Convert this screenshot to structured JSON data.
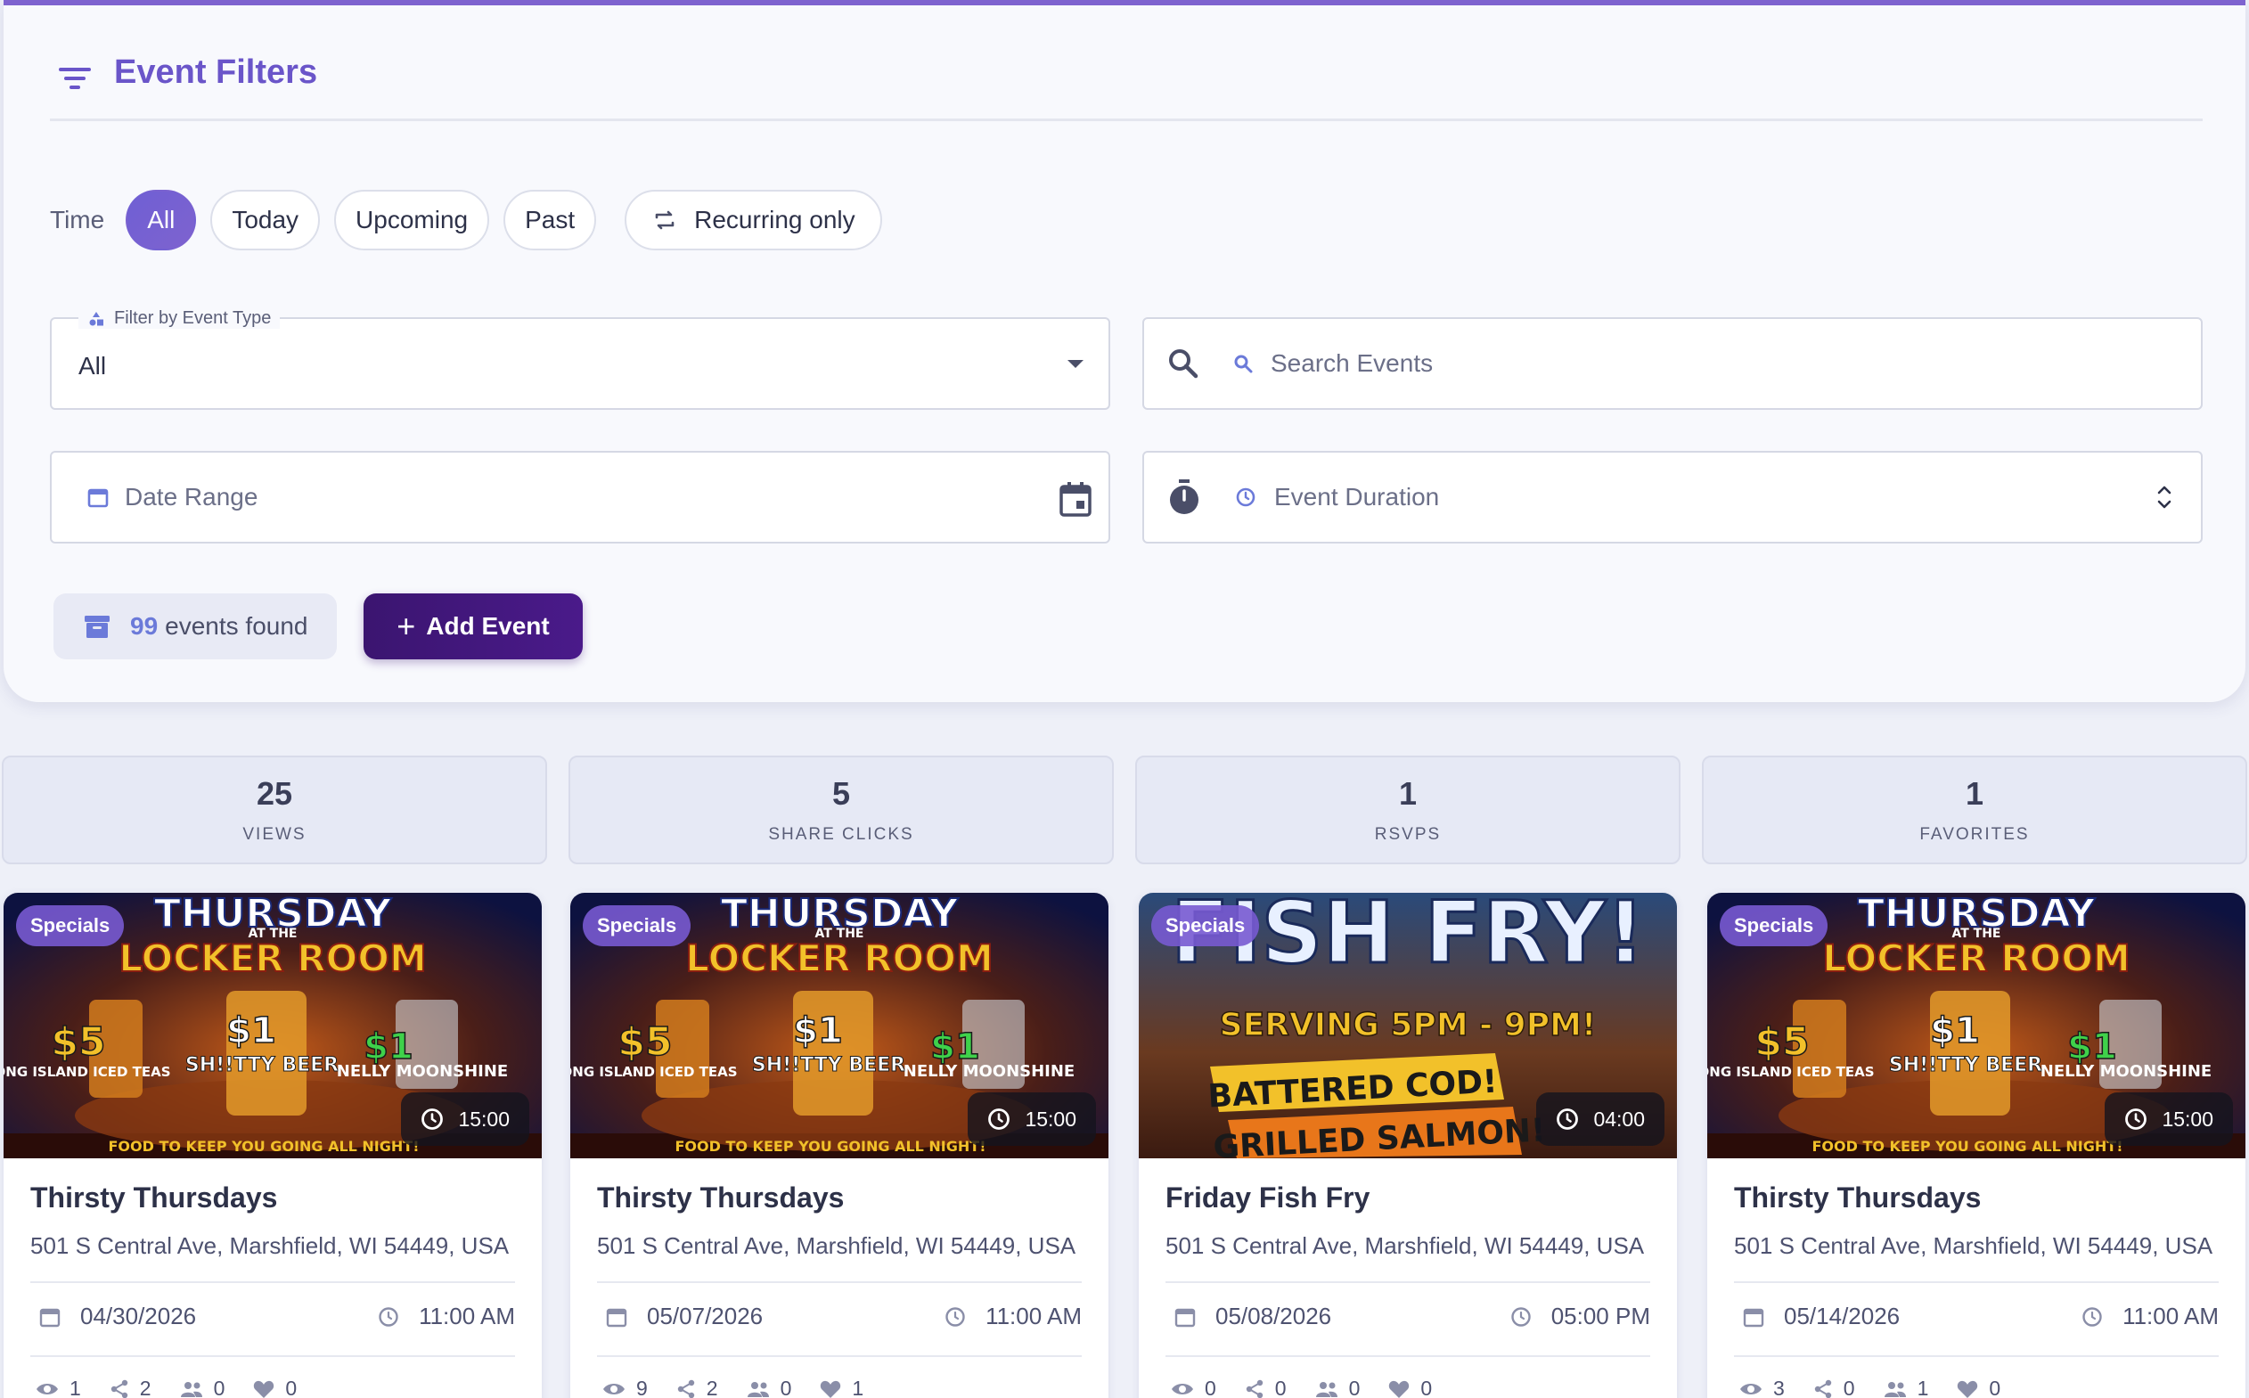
{
  "filters": {
    "title": "Event Filters",
    "time_label": "Time",
    "time_chips": [
      "All",
      "Today",
      "Upcoming",
      "Past"
    ],
    "recurring_label": "Recurring only",
    "event_type": {
      "label": "Filter by Event Type",
      "value": "All"
    },
    "search": {
      "placeholder": "Search Events"
    },
    "date_range": {
      "placeholder": "Date Range"
    },
    "duration": {
      "placeholder": "Event Duration"
    },
    "events_found_count": "99",
    "events_found_text": "events found",
    "add_event_label": "Add Event"
  },
  "stats": [
    {
      "value": "25",
      "label": "VIEWS"
    },
    {
      "value": "5",
      "label": "SHARE CLICKS"
    },
    {
      "value": "1",
      "label": "RSVPS"
    },
    {
      "value": "1",
      "label": "FAVORITES"
    }
  ],
  "events": [
    {
      "badge": "Specials",
      "time": "15:00",
      "title": "Thirsty Thursdays",
      "address": "501 S Central Ave, Marshfield, WI 54449, USA",
      "date": "04/30/2026",
      "start": "11:00 AM",
      "views": "1",
      "shares": "2",
      "rsvps": "0",
      "favorites": "0",
      "flyer": {
        "line1": "THURSDAY",
        "line2": "AT THE",
        "line3": "LOCKER ROOM",
        "p1": "$5",
        "p1t": "LONG ISLAND ICED TEAS",
        "p2": "$1",
        "p2t": "SH!!TTY BEER",
        "p3": "$1",
        "p3t": "NELLY MOONSHINE",
        "footer": "FOOD TO KEEP YOU GOING ALL NIGHT!"
      }
    },
    {
      "badge": "Specials",
      "time": "15:00",
      "title": "Thirsty Thursdays",
      "address": "501 S Central Ave, Marshfield, WI 54449, USA",
      "date": "05/07/2026",
      "start": "11:00 AM",
      "views": "9",
      "shares": "2",
      "rsvps": "0",
      "favorites": "1",
      "flyer": {
        "line1": "THURSDAY",
        "line2": "AT THE",
        "line3": "LOCKER ROOM",
        "p1": "$5",
        "p1t": "LONG ISLAND ICED TEAS",
        "p2": "$1",
        "p2t": "SH!!TTY BEER",
        "p3": "$1",
        "p3t": "NELLY MOONSHINE",
        "footer": "FOOD TO KEEP YOU GOING ALL NIGHT!"
      }
    },
    {
      "badge": "Specials",
      "time": "04:00",
      "title": "Friday Fish Fry",
      "address": "501 S Central Ave, Marshfield, WI 54449, USA",
      "date": "05/08/2026",
      "start": "05:00 PM",
      "views": "0",
      "shares": "0",
      "rsvps": "0",
      "favorites": "0",
      "flyer": {
        "line1": "FISH FRY!",
        "line2": "SERVING 5PM - 9PM!",
        "line3": "BATTERED COD!",
        "line4": "GRILLED SALMON!"
      }
    },
    {
      "badge": "Specials",
      "time": "15:00",
      "title": "Thirsty Thursdays",
      "address": "501 S Central Ave, Marshfield, WI 54449, USA",
      "date": "05/14/2026",
      "start": "11:00 AM",
      "views": "3",
      "shares": "0",
      "rsvps": "1",
      "favorites": "0",
      "flyer": {
        "line1": "THURSDAY",
        "line2": "AT THE",
        "line3": "LOCKER ROOM",
        "p1": "$5",
        "p1t": "LONG ISLAND ICED TEAS",
        "p2": "$1",
        "p2t": "SH!!TTY BEER",
        "p3": "$1",
        "p3t": "NELLY MOONSHINE",
        "footer": "FOOD TO KEEP YOU GOING ALL NIGHT!"
      }
    }
  ]
}
